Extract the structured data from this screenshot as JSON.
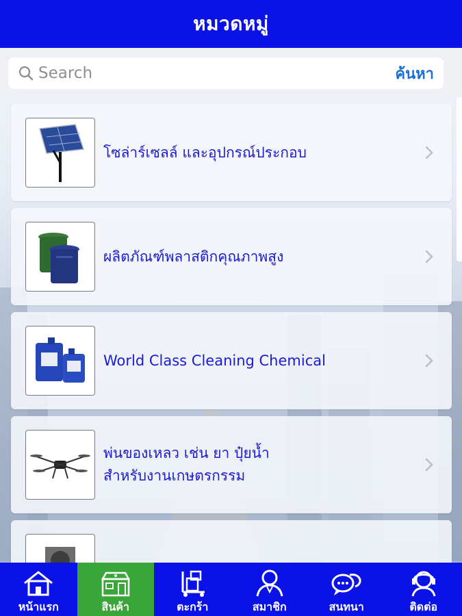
{
  "header": {
    "title": "หมวดหมู่"
  },
  "search": {
    "placeholder": "Search",
    "button_label": "ค้นหา"
  },
  "categories": [
    {
      "label": "โซล่าร์เซลล์ และอุปกรณ์ประกอบ",
      "icon": "solar-panel-thumbnail"
    },
    {
      "label": "ผลิตภัณฑ์พลาสติกคุณภาพสูง",
      "icon": "plastic-bins-thumbnail"
    },
    {
      "label": "World Class Cleaning Chemical",
      "icon": "chemical-containers-thumbnail"
    },
    {
      "label_line1": "พ่นของเหลว เช่น ยา ปุ๋ยน้ำ",
      "label_line2": "สำหรับงานเกษตรกรรม",
      "icon": "drone-thumbnail"
    },
    {
      "label": "",
      "icon": "fan-thumbnail"
    }
  ],
  "tabs": [
    {
      "label": "หน้าแรก",
      "icon": "home-icon",
      "active": false
    },
    {
      "label": "สินค้า",
      "icon": "shop-icon",
      "active": true
    },
    {
      "label": "ตะกร้า",
      "icon": "cart-icon",
      "active": false
    },
    {
      "label": "สมาชิก",
      "icon": "member-icon",
      "active": false
    },
    {
      "label": "สนทนา",
      "icon": "chat-icon",
      "active": false
    },
    {
      "label": "ติดต่อ",
      "icon": "contact-icon",
      "active": false
    }
  ],
  "colors": {
    "header": "#0a12e6",
    "active_tab": "#3aa63a",
    "link": "#1a6fd0",
    "item_text": "#1b1bd2"
  }
}
